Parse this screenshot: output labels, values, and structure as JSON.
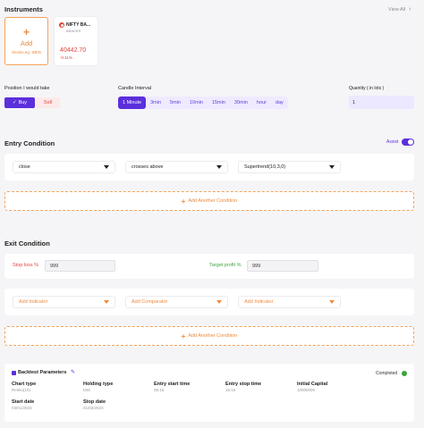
{
  "instruments": {
    "title": "Instruments",
    "view_all": "View All",
    "add_label": "Add",
    "add_hint": "Stocks,eg: SBIN",
    "card": {
      "name": "NIFTY BA...",
      "type": "INDICES",
      "price": "40442.70",
      "change": "-0.11%"
    }
  },
  "position": {
    "label": "Position I would take",
    "buy": "Buy",
    "sell": "Sell"
  },
  "candle": {
    "label": "Candle Interval",
    "options": [
      "1 Minute",
      "3min",
      "5min",
      "10min",
      "15min",
      "30min",
      "hour",
      "day"
    ],
    "selected": "1 Minute"
  },
  "quantity": {
    "label": "Quantity ( in lots )",
    "value": "1"
  },
  "entry": {
    "title": "Entry Condition",
    "assist_label": "Assist",
    "indicator": "close",
    "comparator": "crosses above",
    "target": "Supertrend(10,3,0)",
    "add_label": "Add Another Condition"
  },
  "exit": {
    "title": "Exit Condition",
    "stop_loss_label": "Stop loss %",
    "stop_loss_value": "999",
    "target_profit_label": "Target profit %",
    "target_profit_value": "999",
    "indicator_placeholder": "Add Indicator",
    "comparator_placeholder": "Add Comparator",
    "indicator2_placeholder": "Add Indicator",
    "add_label": "Add Another Condition"
  },
  "backtest": {
    "title": "Backtest Parameters",
    "status": "Completed",
    "chart_type_label": "Chart type",
    "chart_type_value": "Renko(10)",
    "holding_type_label": "Holding type",
    "holding_type_value": "MIS",
    "entry_start_label": "Entry start time",
    "entry_start_value": "09:16",
    "entry_stop_label": "Entry stop time",
    "entry_stop_value": "15:15",
    "capital_label": "Initial Capital",
    "capital_value": "10000000",
    "start_date_label": "Start date",
    "start_date_value": "03/01/2023",
    "stop_date_label": "Stop date",
    "stop_date_value": "01/02/2023"
  },
  "colors": {
    "accent": "#5b2fdc",
    "orange": "#f08a3c",
    "red": "#e0443e",
    "green": "#3ca53c"
  }
}
